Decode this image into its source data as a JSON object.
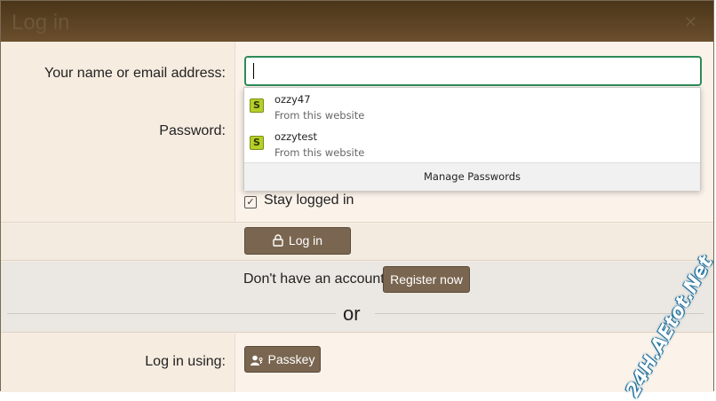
{
  "dialog": {
    "title": "Log in",
    "close_glyph": "✕"
  },
  "form": {
    "name_label": "Your name or email address:",
    "name_value": "",
    "password_label": "Password:",
    "stay_logged_in": "Stay logged in",
    "stay_checked": true,
    "login_button": "Log in",
    "no_account_text": "Don't have an account?",
    "register_button": "Register now",
    "or_text": "or",
    "login_using_label": "Log in using:",
    "passkey_button": "Passkey"
  },
  "autocomplete": {
    "accounts": [
      {
        "name": "ozzy47",
        "source": "From this website",
        "icon": "site-favicon-icon"
      },
      {
        "name": "ozzytest",
        "source": "From this website",
        "icon": "site-favicon-icon"
      }
    ],
    "manage_label": "Manage Passwords"
  },
  "watermark": "24H.AEtot.Net",
  "colors": {
    "header": "#5a4022",
    "button": "#7a6650",
    "focus_border": "#2e8b57",
    "favicon": "#b6cf2a"
  }
}
